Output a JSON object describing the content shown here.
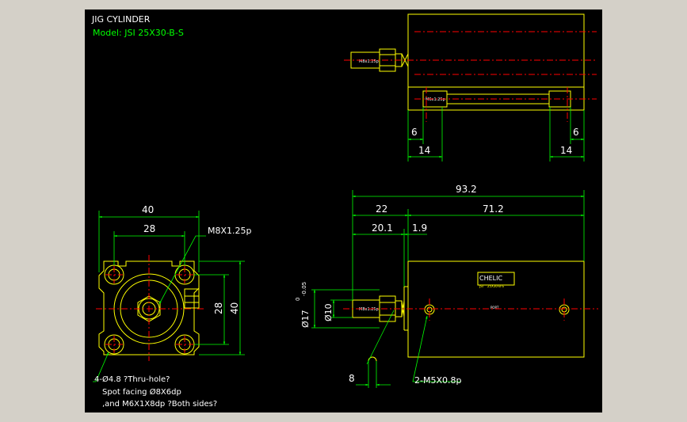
{
  "title_block": {
    "title": "JIG CYLINDER",
    "model": "Model: JSI 25X30-B-S"
  },
  "labels": {
    "rod_tag": "M8x1.25p",
    "bottom_tag": "M6x1.25p",
    "brand_tag": "CHELIC",
    "brand_sub1": "JSI",
    "brand_sub2": "25X30-B-S",
    "port_tag": "PORT"
  },
  "dimensions": {
    "top_left_6": "6",
    "top_left_14": "14",
    "top_right_6": "6",
    "top_right_14": "14",
    "front_width_40": "40",
    "front_width_28": "28",
    "front_height_28": "28",
    "front_height_40": "40",
    "thread_callout": "M8X1.25p",
    "overall_93_2": "93.2",
    "dim_22": "22",
    "dim_71_2": "71.2",
    "dim_20_1": "20.1",
    "dim_1_9": "1.9",
    "dia_10": "Ø10",
    "dia_17": "Ø17",
    "dia_17_tol_upper": "0",
    "dia_17_tol_lower": "-0.05",
    "dim_8": "8",
    "port_callout": "2-M5X0.8p"
  },
  "notes": {
    "line1": "4-Ø4.8 ?Thru-hole?",
    "line2": "Spot facing  Ø8X6dp",
    "line3": ",and M6X1X8dp ?Both sides?"
  },
  "colors": {
    "paper": "#000000",
    "frame": "#d4d0c8",
    "outline": "#ffff00",
    "dimension": "#00ff00",
    "centerline": "#ff0000",
    "text": "#ffffff"
  }
}
